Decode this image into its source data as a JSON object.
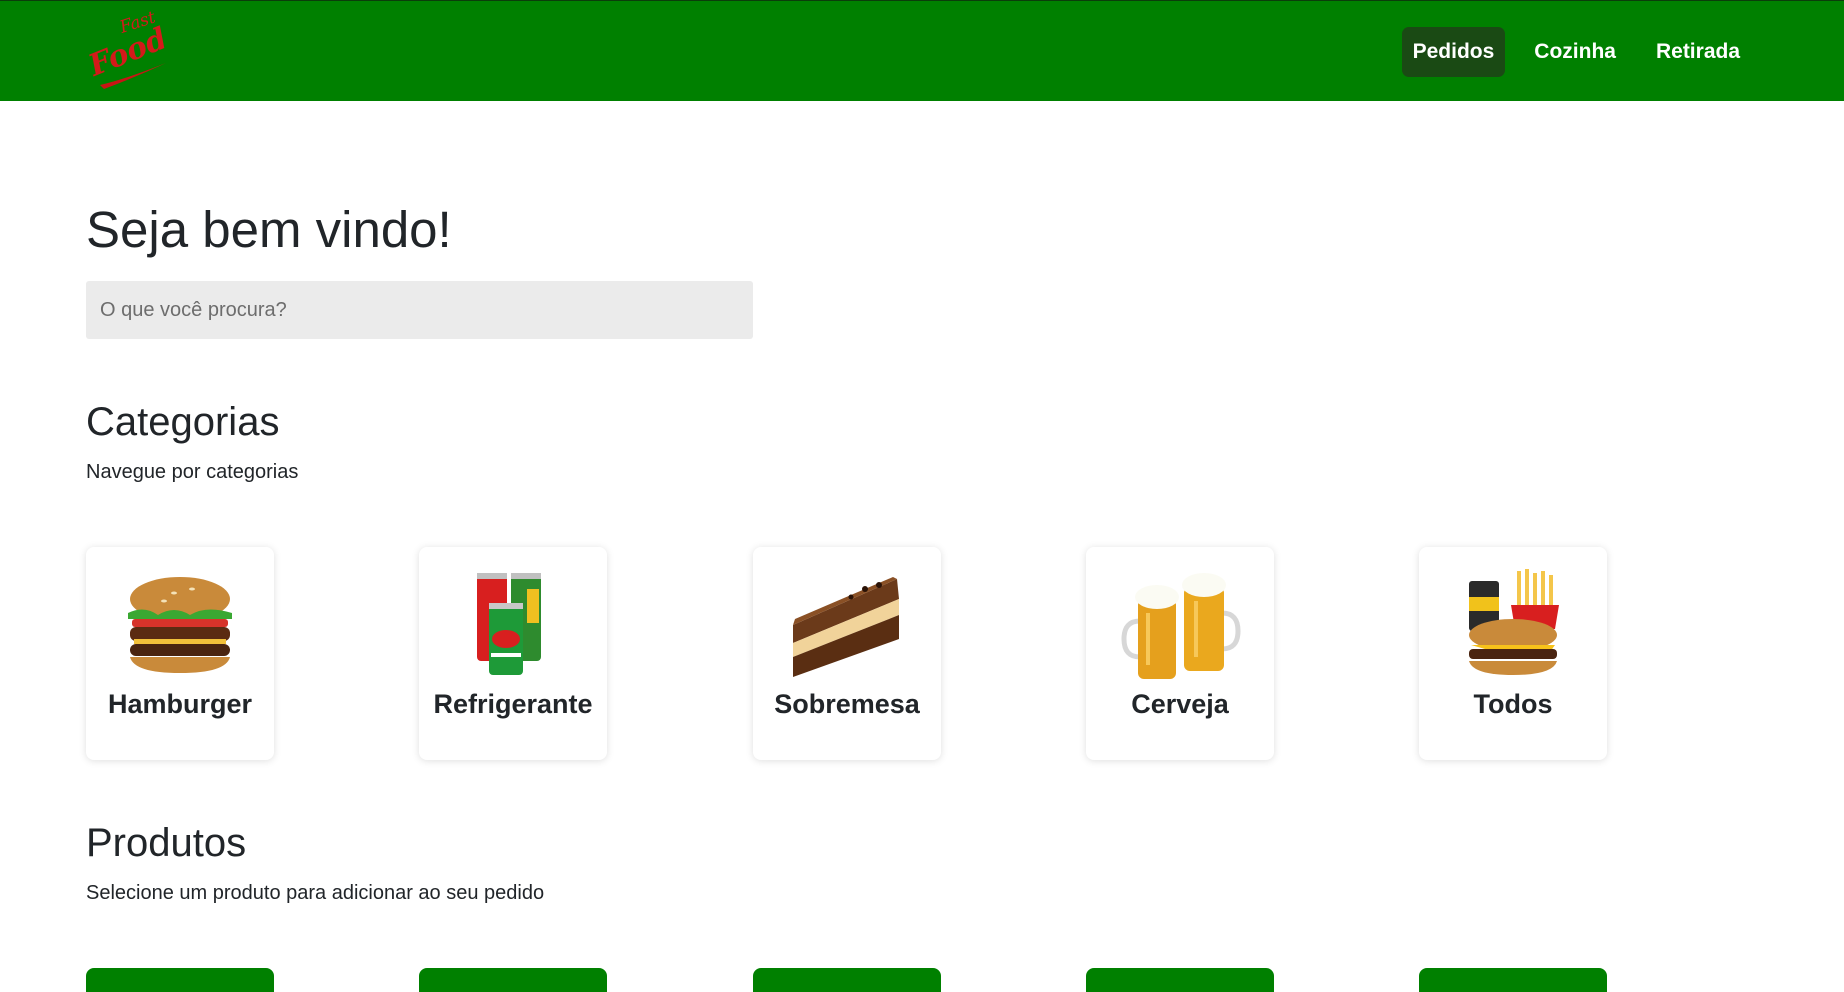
{
  "navbar": {
    "logo": {
      "line1": "Fast",
      "line2": "Food"
    },
    "links": [
      {
        "label": "Pedidos",
        "active": true
      },
      {
        "label": "Cozinha",
        "active": false
      },
      {
        "label": "Retirada",
        "active": false
      }
    ],
    "colors": {
      "background": "#008000",
      "active_link": "#1a4a14"
    }
  },
  "main": {
    "welcome": "Seja bem vindo!",
    "search": {
      "placeholder": "O que você procura?",
      "value": ""
    },
    "categories": {
      "title": "Categorias",
      "subtitle": "Navegue por categorias",
      "items": [
        {
          "label": "Hamburger",
          "icon": "hamburger-image"
        },
        {
          "label": "Refrigerante",
          "icon": "soda-cans-image"
        },
        {
          "label": "Sobremesa",
          "icon": "cake-slice-image"
        },
        {
          "label": "Cerveja",
          "icon": "beer-mugs-image"
        },
        {
          "label": "Todos",
          "icon": "combo-meal-image"
        }
      ]
    },
    "products": {
      "title": "Produtos",
      "subtitle": "Selecione um produto para adicionar ao seu pedido",
      "visible_cards": 5
    }
  }
}
